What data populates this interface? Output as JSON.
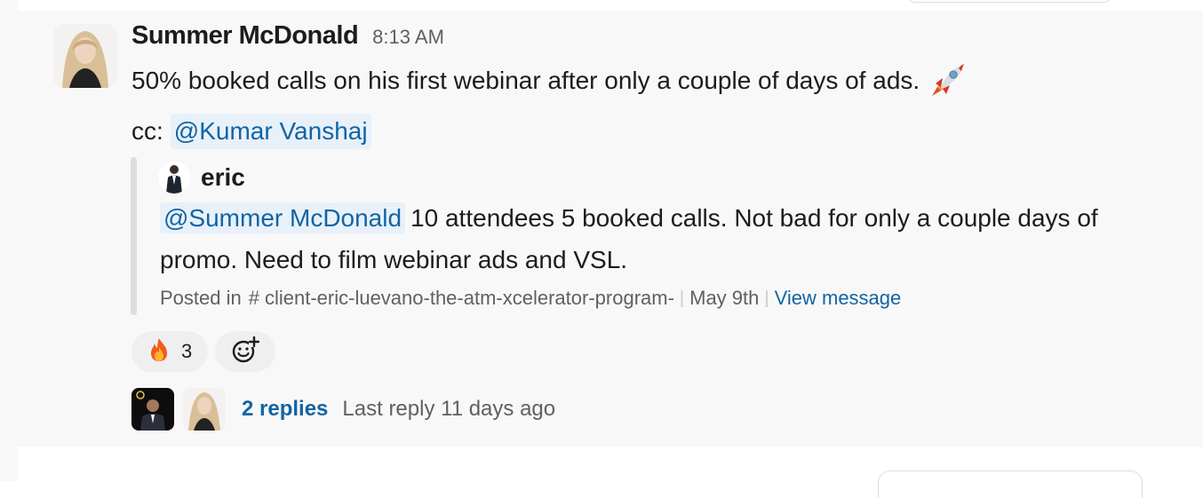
{
  "message": {
    "sender": "Summer McDonald",
    "time": "8:13 AM",
    "text": "50% booked calls on his first webinar after only a couple of days of ads.",
    "emoji_icon": "rocket-icon",
    "cc_prefix": "cc:",
    "cc_mention": "@Kumar Vanshaj"
  },
  "quote": {
    "author": "eric",
    "mention": "@Summer McDonald",
    "text": "10 attendees 5 booked calls. Not bad for only a couple days of promo. Need to film webinar ads and VSL.",
    "posted_in": "Posted in",
    "channel": "client-eric-luevano-the-atm-xcelerator-program-",
    "date": "May 9th",
    "view_link": "View message"
  },
  "reactions": [
    {
      "icon": "fire-icon",
      "count": "3"
    }
  ],
  "add_reaction_icon": "add-reaction-icon",
  "thread": {
    "replies": "2 replies",
    "last_reply": "Last reply 11 days ago"
  },
  "colors": {
    "link": "#1264a3",
    "mention_bg": "#e8f1fa",
    "hover_bg": "#f8f8f8"
  }
}
